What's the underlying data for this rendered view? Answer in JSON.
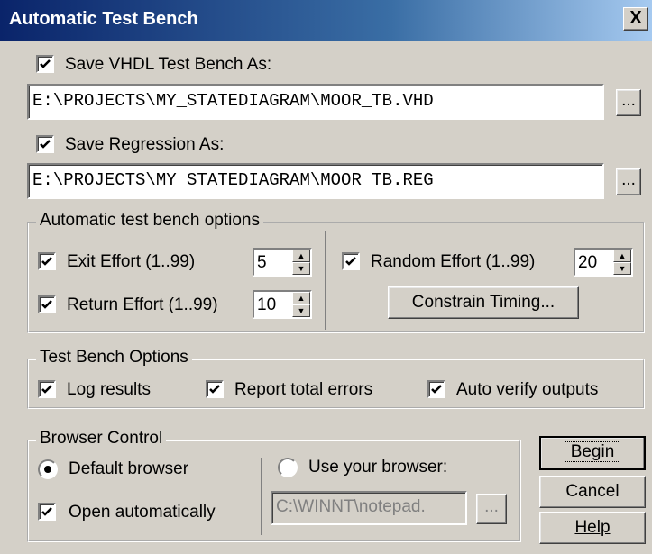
{
  "window": {
    "title": "Automatic Test Bench",
    "close_label": "X"
  },
  "vhdl": {
    "checkbox_label": "Save VHDL Test Bench As:",
    "checked": true,
    "path": "E:\\PROJECTS\\MY_STATEDIAGRAM\\MOOR_TB.VHD",
    "browse_label": "..."
  },
  "regression": {
    "checkbox_label": "Save Regression As:",
    "checked": true,
    "path": "E:\\PROJECTS\\MY_STATEDIAGRAM\\MOOR_TB.REG",
    "browse_label": "..."
  },
  "atb_options": {
    "legend": "Automatic test bench options",
    "exit_effort": {
      "label": "Exit Effort (1..99)",
      "checked": true,
      "value": "5"
    },
    "return_effort": {
      "label": "Return Effort (1..99)",
      "checked": true,
      "value": "10"
    },
    "random_effort": {
      "label": "Random Effort (1..99)",
      "checked": true,
      "value": "20"
    },
    "constrain_timing_label": "Constrain Timing..."
  },
  "tb_options": {
    "legend": "Test Bench Options",
    "log_results": "Log results",
    "report_total_errors": "Report total errors",
    "auto_verify_outputs": "Auto verify outputs"
  },
  "browser_control": {
    "legend": "Browser Control",
    "default_browser": "Default browser",
    "open_automatically": "Open automatically",
    "use_your_browser": "Use your browser:",
    "browser_path": "C:\\WINNT\\notepad.",
    "browse_label": "..."
  },
  "buttons": {
    "begin": "Begin",
    "cancel": "Cancel",
    "help": "Help"
  }
}
